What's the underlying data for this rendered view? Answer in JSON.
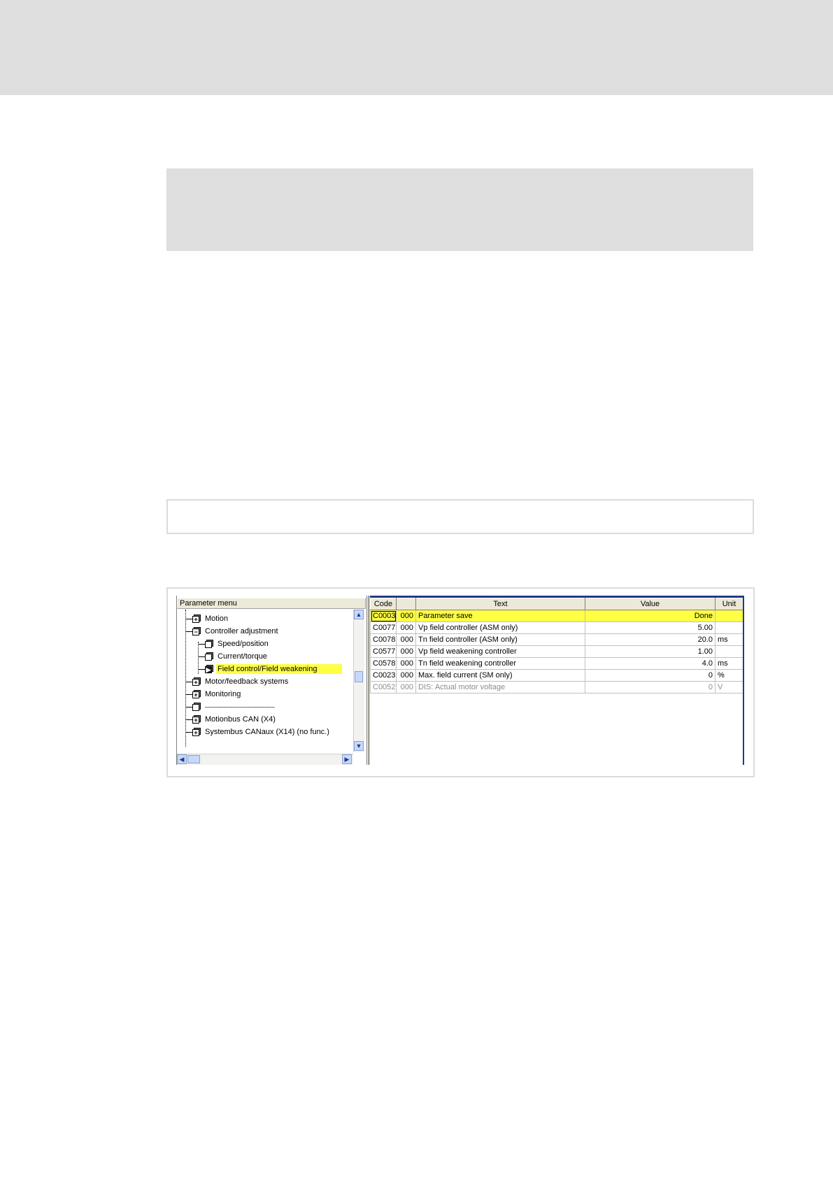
{
  "tree": {
    "title": "Parameter menu",
    "items": [
      {
        "label": "Motion",
        "icon": "plus-node-icon"
      },
      {
        "label": "Controller adjustment",
        "icon": "minus-node-icon"
      },
      {
        "label": "Speed/position",
        "icon": "leaf-node-icon"
      },
      {
        "label": "Current/torque",
        "icon": "leaf-node-icon"
      },
      {
        "label": "Field control/Field weakening",
        "icon": "play-node-icon",
        "selected": true
      },
      {
        "label": "Motor/feedback systems",
        "icon": "plus-node-icon"
      },
      {
        "label": "Monitoring",
        "icon": "plus-node-icon"
      },
      {
        "label": "----------------------------------------------",
        "icon": "leaf-node-icon"
      },
      {
        "label": "Motionbus CAN (X4)",
        "icon": "plus-node-icon"
      },
      {
        "label": "Systembus CANaux (X14)  (no func.)",
        "icon": "plus-node-icon"
      }
    ]
  },
  "grid": {
    "headers": {
      "code": "Code",
      "sub": "",
      "text": "Text",
      "value": "Value",
      "unit": "Unit"
    },
    "rows": [
      {
        "code": "C0003",
        "sub": "000",
        "text": "Parameter save",
        "value": "Done",
        "unit": ""
      },
      {
        "code": "C0077",
        "sub": "000",
        "text": "Vp field controller (ASM only)",
        "value": "5.00",
        "unit": ""
      },
      {
        "code": "C0078",
        "sub": "000",
        "text": "Tn field controller (ASM only)",
        "value": "20.0",
        "unit": "ms"
      },
      {
        "code": "C0577",
        "sub": "000",
        "text": "Vp field weakening controller",
        "value": "1.00",
        "unit": ""
      },
      {
        "code": "C0578",
        "sub": "000",
        "text": "Tn field weakening controller",
        "value": "4.0",
        "unit": "ms"
      },
      {
        "code": "C0023",
        "sub": "000",
        "text": "Max. field current (SM only)",
        "value": "0",
        "unit": "%"
      },
      {
        "code": "C0052",
        "sub": "000",
        "text": "DIS: Actual motor voltage",
        "value": "0",
        "unit": "V"
      }
    ]
  },
  "colors": {
    "highlight": "#ffff44",
    "frame": "#1c3c8c",
    "disabled_text": "#8a8a8a"
  }
}
